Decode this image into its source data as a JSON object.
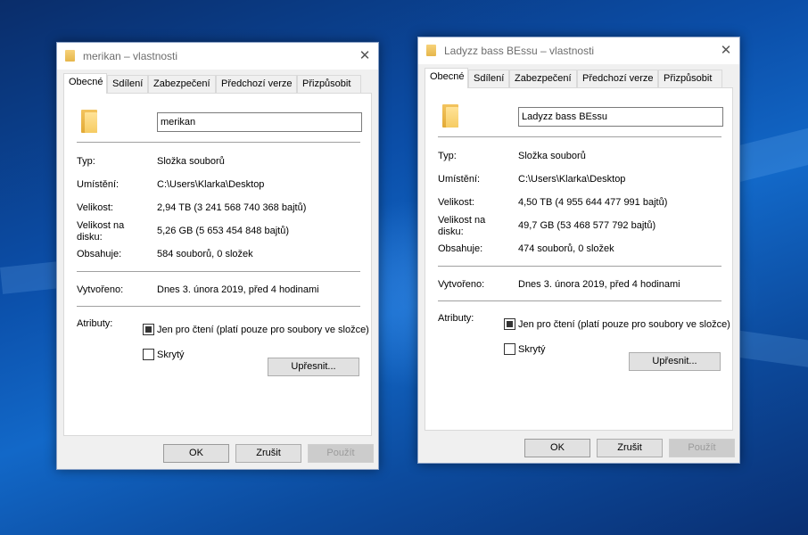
{
  "dialogs": [
    {
      "title": "merikan – vlastnosti",
      "close_glyph": "✕",
      "tabs": [
        "Obecné",
        "Sdílení",
        "Zabezpečení",
        "Předchozí verze",
        "Přizpůsobit"
      ],
      "name": "merikan",
      "props": {
        "type_label": "Typ:",
        "type_value": "Složka souborů",
        "location_label": "Umístění:",
        "location_value": "C:\\Users\\Klarka\\Desktop",
        "size_label": "Velikost:",
        "size_value": "2,94 TB (3 241 568 740 368 bajtů)",
        "disk_label": "Velikost na disku:",
        "disk_value": "5,26 GB (5 653 454 848 bajtů)",
        "contains_label": "Obsahuje:",
        "contains_value": "584 souborů, 0 složek",
        "created_label": "Vytvořeno:",
        "created_value": "Dnes 3. února 2019, před 4 hodinami",
        "attributes_label": "Atributy:",
        "readonly_label": "Jen pro čtení (platí pouze pro soubory ve složce)",
        "readonly_state": "indeterminate",
        "hidden_label": "Skrytý",
        "hidden_state": "unchecked",
        "advanced_button": "Upřesnit..."
      },
      "buttons": {
        "ok": "OK",
        "cancel": "Zrušit",
        "apply": "Použít"
      }
    },
    {
      "title": "Ladyzz bass BEssu – vlastnosti",
      "close_glyph": "✕",
      "tabs": [
        "Obecné",
        "Sdílení",
        "Zabezpečení",
        "Předchozí verze",
        "Přizpůsobit"
      ],
      "name": "Ladyzz bass BEssu",
      "props": {
        "type_label": "Typ:",
        "type_value": "Složka souborů",
        "location_label": "Umístění:",
        "location_value": "C:\\Users\\Klarka\\Desktop",
        "size_label": "Velikost:",
        "size_value": "4,50 TB (4 955 644 477 991 bajtů)",
        "disk_label": "Velikost na disku:",
        "disk_value": "49,7 GB (53 468 577 792 bajtů)",
        "contains_label": "Obsahuje:",
        "contains_value": "474 souborů, 0 složek",
        "created_label": "Vytvořeno:",
        "created_value": "Dnes 3. února 2019, před 4 hodinami",
        "attributes_label": "Atributy:",
        "readonly_label": "Jen pro čtení (platí pouze pro soubory ve složce)",
        "readonly_state": "indeterminate",
        "hidden_label": "Skrytý",
        "hidden_state": "unchecked",
        "advanced_button": "Upřesnit..."
      },
      "buttons": {
        "ok": "OK",
        "cancel": "Zrušit",
        "apply": "Použít"
      }
    }
  ],
  "icons": {
    "title_folder": "folder-icon",
    "large_folder": "folder-icon",
    "close": "close-icon"
  },
  "colors": {
    "desktop_dark": "#0a2d6a",
    "desktop_light": "#1268c8",
    "dialog_bg": "#f0f0f0",
    "panel_bg": "#ffffff"
  }
}
